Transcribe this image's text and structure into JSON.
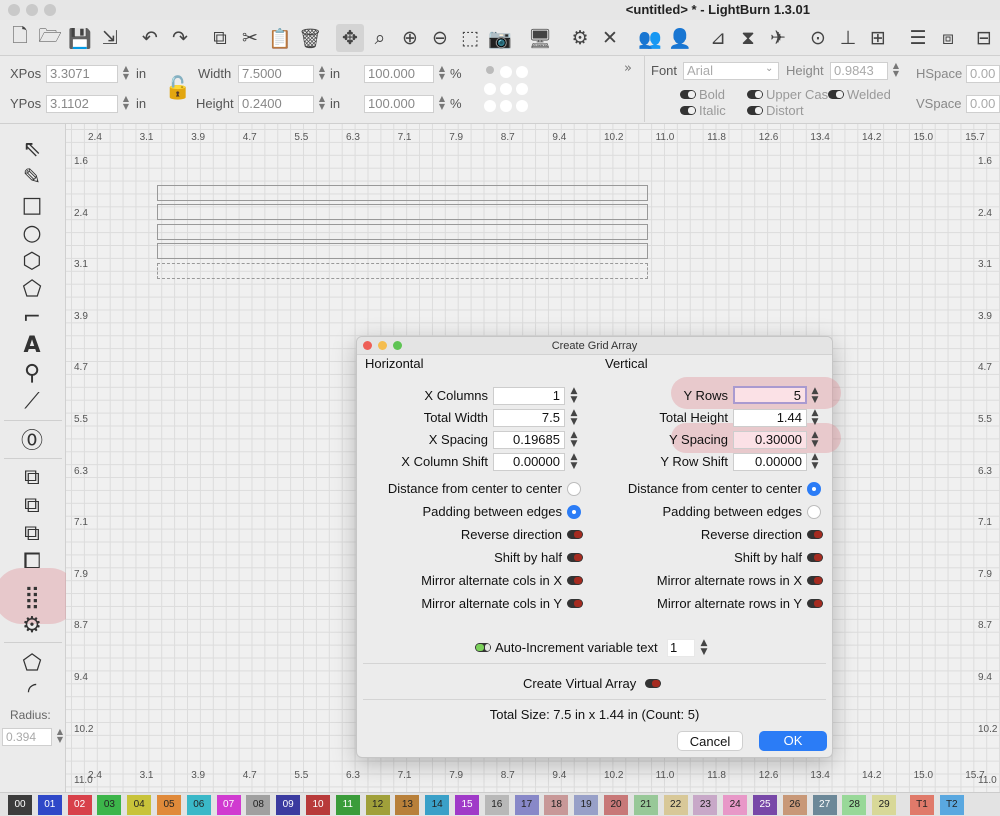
{
  "window": {
    "title": "<untitled> * - LightBurn 1.3.01"
  },
  "toolbar": {
    "icons": [
      "new-file-icon",
      "open-folder-icon",
      "save-icon",
      "import-icon",
      "undo-icon",
      "redo-icon",
      "copy-icon",
      "cut-icon",
      "paste-icon",
      "delete-icon",
      "move-icon",
      "zoom-selection-icon",
      "zoom-in-icon",
      "zoom-out-icon",
      "frame-icon",
      "camera-icon",
      "monitor-icon",
      "settings-icon",
      "tools-icon",
      "users-icon",
      "user-icon",
      "align-icon",
      "mirror-icon",
      "send-icon",
      "target-icon",
      "node-icon",
      "group-icon",
      "distribute-icon",
      "align-h-icon",
      "dock-icon"
    ]
  },
  "props": {
    "xpos_label": "XPos",
    "xpos_value": "3.3071",
    "xpos_unit": "in",
    "ypos_label": "YPos",
    "ypos_value": "3.1102",
    "ypos_unit": "in",
    "width_label": "Width",
    "width_value": "7.5000",
    "width_unit": "in",
    "height_label": "Height",
    "height_value": "0.2400",
    "height_unit": "in",
    "scale_w": "100.000",
    "scale_h": "100.000",
    "pct": "%",
    "font_label": "Font",
    "font_value": "Arial",
    "fheight_label": "Height",
    "fheight_value": "0.9843",
    "hspace_label": "HSpace",
    "hspace_value": "0.00",
    "vspace_label": "VSpace",
    "vspace_value": "0.00",
    "bold": "Bold",
    "italic": "Italic",
    "upper": "Upper Case",
    "welded": "Welded",
    "distort": "Distort"
  },
  "ruler": {
    "top": [
      "2.4",
      "3.1",
      "3.9",
      "4.7",
      "5.5",
      "6.3",
      "7.1",
      "7.9",
      "8.7",
      "9.4",
      "10.2",
      "11.0",
      "11.8",
      "12.6",
      "13.4",
      "14.2",
      "15.0",
      "15.7"
    ],
    "left": [
      "1.6",
      "2.4",
      "3.1",
      "3.9",
      "4.7",
      "5.5",
      "6.3",
      "7.1",
      "7.9",
      "8.7",
      "9.4",
      "10.2",
      "11.0"
    ],
    "right": [
      "1.6",
      "2.4",
      "3.1",
      "3.9",
      "4.7",
      "5.5",
      "6.3",
      "7.1",
      "7.9",
      "8.7",
      "9.4",
      "10.2",
      "11.0"
    ]
  },
  "lefttools": {
    "radius_label": "Radius:",
    "radius_value": "0.394"
  },
  "dialog": {
    "title": "Create Grid Array",
    "horizontal": "Horizontal",
    "vertical": "Vertical",
    "x_columns_label": "X Columns",
    "x_columns": "1",
    "total_width_label": "Total Width",
    "total_width": "7.5",
    "x_spacing_label": "X Spacing",
    "x_spacing": "0.19685",
    "x_col_shift_label": "X Column Shift",
    "x_col_shift": "0.00000",
    "y_rows_label": "Y Rows",
    "y_rows": "5",
    "total_height_label": "Total Height",
    "total_height": "1.44",
    "y_spacing_label": "Y Spacing",
    "y_spacing": "0.30000",
    "y_row_shift_label": "Y Row Shift",
    "y_row_shift": "0.00000",
    "dist_center": "Distance from center to center",
    "padding_edges": "Padding between edges",
    "reverse": "Reverse direction",
    "shift_half": "Shift by half",
    "mirror_cols_x": "Mirror alternate cols in X",
    "mirror_cols_y": "Mirror alternate cols in Y",
    "mirror_rows_x": "Mirror alternate rows in X",
    "mirror_rows_y": "Mirror alternate rows in Y",
    "auto_inc": "Auto-Increment variable text",
    "auto_inc_value": "1",
    "virtual": "Create Virtual Array",
    "total_size": "Total Size: 7.5 in x 1.44 in  (Count: 5)",
    "cancel": "Cancel",
    "ok": "OK"
  },
  "palette": [
    {
      "label": "00",
      "color": "#3c3c3c",
      "text": "#ffffff"
    },
    {
      "label": "01",
      "color": "#2f48c8",
      "text": "#ffffff"
    },
    {
      "label": "02",
      "color": "#d8414a",
      "text": "#ffffff"
    },
    {
      "label": "03",
      "color": "#3cb54a",
      "text": "#222222"
    },
    {
      "label": "04",
      "color": "#c8c33a",
      "text": "#222222"
    },
    {
      "label": "05",
      "color": "#e08a3a",
      "text": "#222222"
    },
    {
      "label": "06",
      "color": "#3ab8c8",
      "text": "#222222"
    },
    {
      "label": "07",
      "color": "#d03ad0",
      "text": "#ffffff"
    },
    {
      "label": "08",
      "color": "#a0a0a0",
      "text": "#222222"
    },
    {
      "label": "09",
      "color": "#3b3ba0",
      "text": "#ffffff"
    },
    {
      "label": "10",
      "color": "#b83a3a",
      "text": "#ffffff"
    },
    {
      "label": "11",
      "color": "#3a9c3a",
      "text": "#ffffff"
    },
    {
      "label": "12",
      "color": "#a0a03a",
      "text": "#222222"
    },
    {
      "label": "13",
      "color": "#b8803a",
      "text": "#222222"
    },
    {
      "label": "14",
      "color": "#3aa0c8",
      "text": "#222222"
    },
    {
      "label": "15",
      "color": "#a03ac8",
      "text": "#ffffff"
    },
    {
      "label": "16",
      "color": "#b8b8b8",
      "text": "#222222"
    },
    {
      "label": "17",
      "color": "#8888c8",
      "text": "#222222"
    },
    {
      "label": "18",
      "color": "#c89898",
      "text": "#222222"
    },
    {
      "label": "19",
      "color": "#98a0c8",
      "text": "#222222"
    },
    {
      "label": "20",
      "color": "#c87878",
      "text": "#222222"
    },
    {
      "label": "21",
      "color": "#98c898",
      "text": "#222222"
    },
    {
      "label": "22",
      "color": "#d8c898",
      "text": "#222222"
    },
    {
      "label": "23",
      "color": "#c8a8c8",
      "text": "#222222"
    },
    {
      "label": "24",
      "color": "#e898c8",
      "text": "#222222"
    },
    {
      "label": "25",
      "color": "#7848a8",
      "text": "#ffffff"
    },
    {
      "label": "26",
      "color": "#c89878",
      "text": "#222222"
    },
    {
      "label": "27",
      "color": "#6c8898",
      "text": "#ffffff"
    },
    {
      "label": "28",
      "color": "#98d898",
      "text": "#222222"
    },
    {
      "label": "29",
      "color": "#d8d898",
      "text": "#222222"
    },
    {
      "label": "T1",
      "color": "#e07a6a",
      "text": "#222222"
    },
    {
      "label": "T2",
      "color": "#5aa8e0",
      "text": "#222222"
    }
  ]
}
